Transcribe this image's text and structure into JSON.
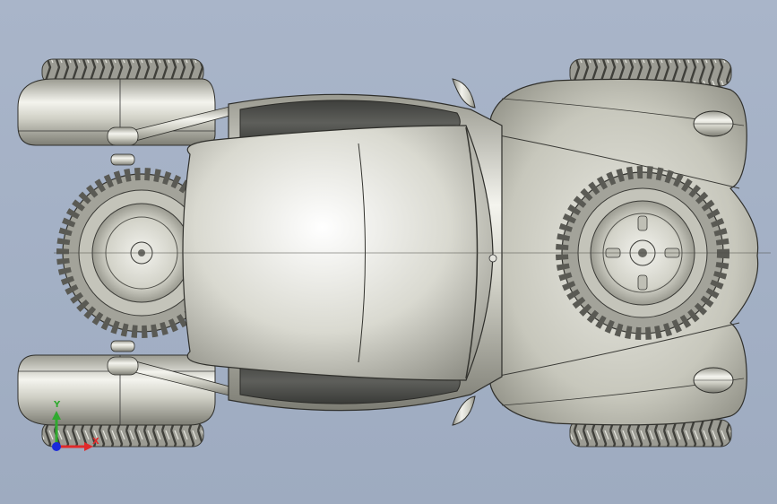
{
  "viewport": {
    "background_top": "#a9b5c9",
    "background_bottom": "#9eabc0"
  },
  "model": {
    "body_color": "#c9c9be",
    "tire_color": "#8c8c84",
    "window_color": "#4e4f4c"
  },
  "triad": {
    "y_label": "Y",
    "x_label": "X",
    "y_color": "#2faa2f",
    "x_color": "#e02a2a",
    "origin_color": "#1a2adb"
  }
}
